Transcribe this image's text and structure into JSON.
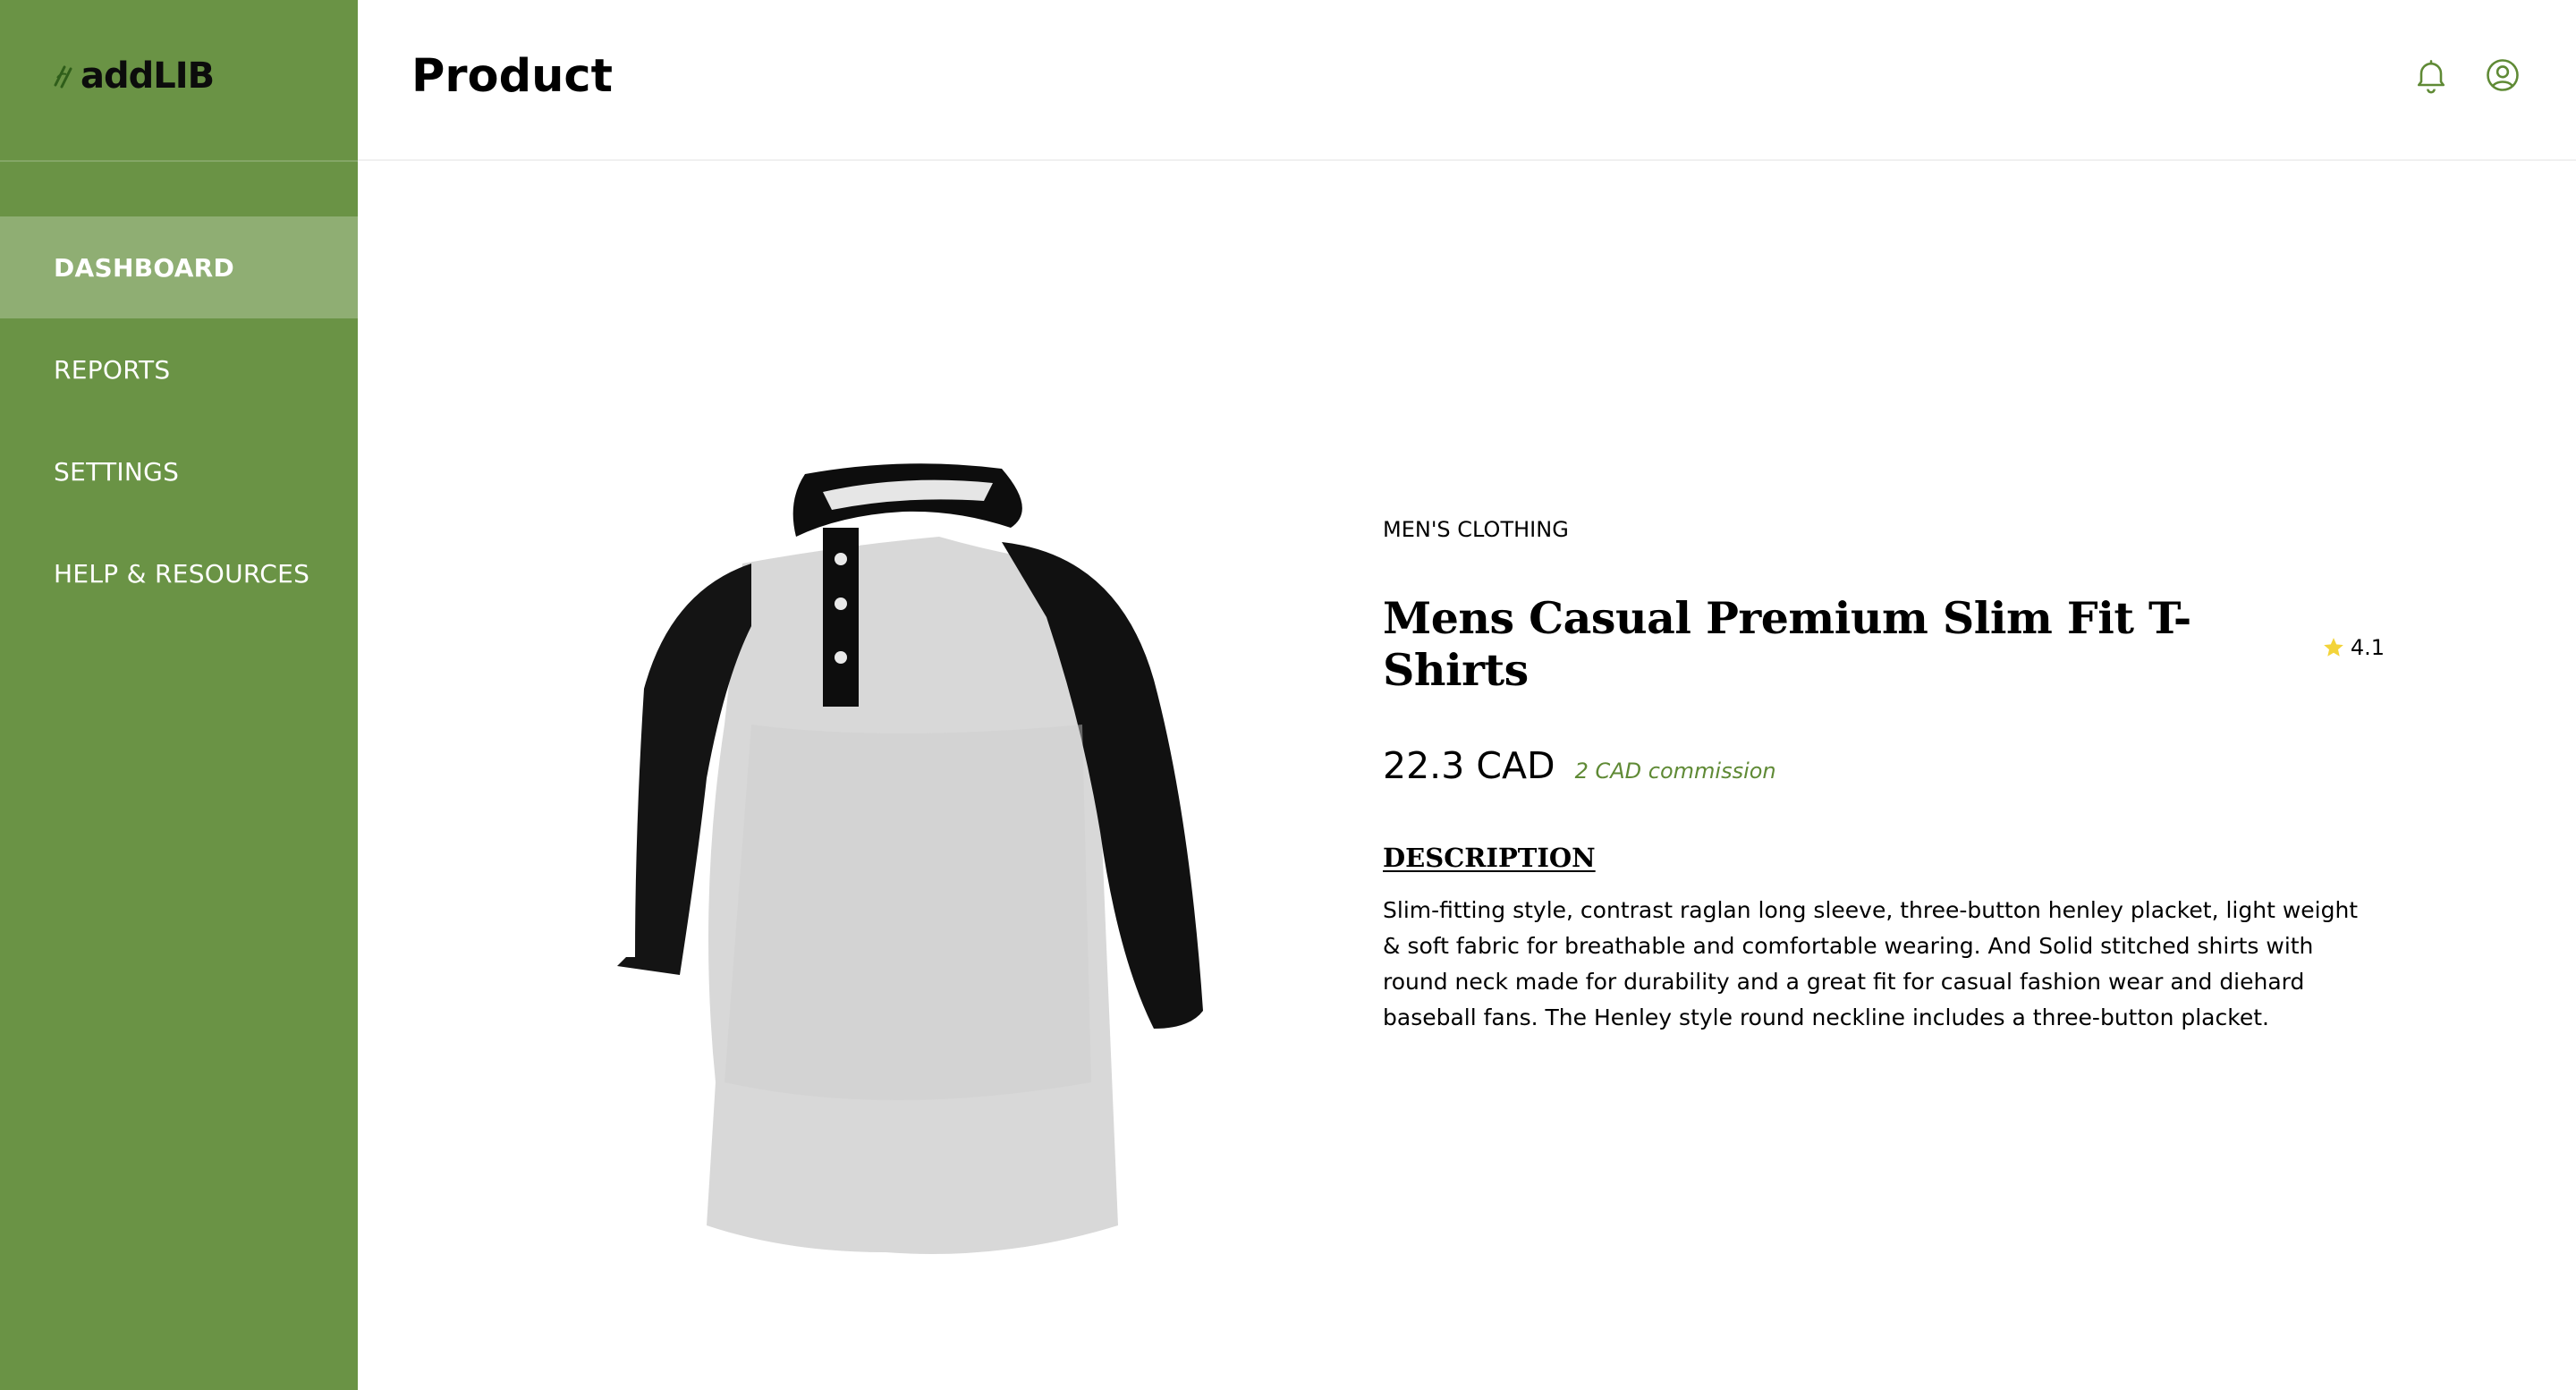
{
  "brand": {
    "name": "addLIB",
    "accent_color": "#6a9345"
  },
  "sidebar": {
    "items": [
      {
        "label": "DASHBOARD",
        "active": true
      },
      {
        "label": "REPORTS",
        "active": false
      },
      {
        "label": "SETTINGS",
        "active": false
      },
      {
        "label": "HELP & RESOURCES",
        "active": false
      }
    ]
  },
  "header": {
    "title": "Product",
    "icons": [
      "bell-icon",
      "user-circle-icon"
    ]
  },
  "product": {
    "image": "raglan-henley-shirt-image",
    "category": "MEN'S CLOTHING",
    "title": "Mens Casual Premium Slim Fit T-Shirts",
    "rating": "4.1",
    "price": "22.3 CAD",
    "commission": "2 CAD commission",
    "description_heading": "DESCRIPTION",
    "description": "Slim-fitting style, contrast raglan long sleeve, three-button henley placket, light weight & soft fabric for breathable and comfortable wearing. And Solid stitched shirts with round neck made for durability and a great fit for casual fashion wear and diehard baseball fans. The Henley style round neckline includes a three-button placket.",
    "star_color": "#f3d43a",
    "commission_color": "#5f8a35"
  }
}
